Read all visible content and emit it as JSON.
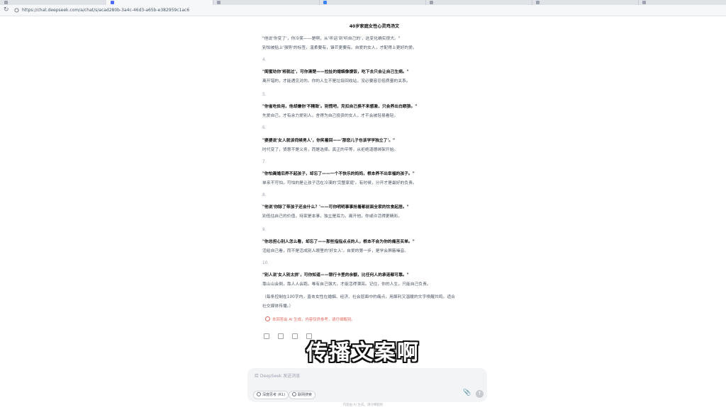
{
  "browser": {
    "url": "https://chat.deepseek.com/a/chat/s/acad280b-3a4c-46d3-a65b-e382959c1ac6",
    "tab_count": 7
  },
  "document": {
    "title": "40岁家庭女性心灵鸡汤文",
    "lines": [
      {
        "type": "body",
        "text": "\"他说'你变了'，你冷笑——是啊，从'听话'到'听自己的'，这变化确实很大。\""
      },
      {
        "type": "body",
        "text": "别怕被贴上'强势'的标签，温柔要有，锋芒更要有。自爱的女人，才配得上更好的爱。"
      },
      {
        "type": "num",
        "text": "4."
      },
      {
        "type": "bold",
        "text": "\"闺蜜劝你'将就过'，可你清楚——拉扯的婚姻像馊饭，吃下去只会让自己生病。\""
      },
      {
        "type": "body",
        "text": "离开错的，才能遇见对的。你的人生不是垃圾回收站，没必要容忍低质量的关系。"
      },
      {
        "type": "num",
        "text": "5."
      },
      {
        "type": "bold",
        "text": "\"你省吃俭用，他却嫌你'不精致'。别慌吧，克扣自己换不来感激，只会养出白眼狼。\""
      },
      {
        "type": "body",
        "text": "先爱自己，才有余力爱别人。舍得为自己投资的女人，才不会被轻易看轻。"
      },
      {
        "type": "num",
        "text": "6."
      },
      {
        "type": "bold",
        "text": "\"婆婆说'女人就该伺候男人'，你笑着回——'那您儿子也该学学独立了'。\""
      },
      {
        "type": "body",
        "text": "时代变了，贤惠不是义务，而是选择。真正的平等，从拒绝道德绑架开始。"
      },
      {
        "type": "num",
        "text": "7."
      },
      {
        "type": "bold",
        "text": "\"你怕离婚后养不起孩子，却忘了——一个不快乐的妈妈，根本养不出幸福的孩子。\""
      },
      {
        "type": "body",
        "text": "单亲不可怕，可怕的是让孩子活在冷漠的'完整家庭'。有时候，分开才是最好的负责。"
      },
      {
        "type": "num",
        "text": "8."
      },
      {
        "type": "bold",
        "text": "\"他说'你除了带孩子还会什么？'——可你明明事事抢着都前面全家的饮食起居。\""
      },
      {
        "type": "body",
        "text": "别低估自己的价值，持家是本事，独立是底力。离开他，你或许活得更精彩。"
      },
      {
        "type": "num",
        "text": "9."
      },
      {
        "type": "bold",
        "text": "\"你总担心别人怎么看，却忘了——那些指指点点的人，根本不会为你的痛苦买单。\""
      },
      {
        "type": "body",
        "text": "活给自己看，而不是活成别人眼里的'好女人'。自爱的第一步，是学会屏蔽噪音。"
      },
      {
        "type": "num",
        "text": "10."
      },
      {
        "type": "bold",
        "text": "\"别人说'女人别太拼'，可你知道——银行卡里的余额，比任何人的承诺都可靠。\""
      },
      {
        "type": "body",
        "text": "靠山山会倒，靠人人会跑。唯有自己强大，才能活得漂亮。记住，你的人生，只能自己负责。"
      },
      {
        "type": "note",
        "text": "（每条控制在100字内，直击女性在婚姻、经济、社会层面中的痛点，用犀利又温暖的文字唤醒共鸣，适合"
      },
      {
        "type": "note",
        "text": "社交媒体传播。）"
      }
    ],
    "disclaimer": "本回答由 AI 生成，内容仅供参考，请仔细甄别。"
  },
  "subtitle": "传播文案啊",
  "composer": {
    "placeholder": "给 DeepSeek 发送消息",
    "deepthink_label": "深度思考 (R1)",
    "search_label": "联网搜索",
    "attach_icon": "📎",
    "send_icon": "↑"
  },
  "footer": "内容由 AI 生成，请仔细甄别",
  "colors": {
    "accent": "#4d6bfe",
    "disclaimer": "#e46a5f",
    "tabbar": "#dfe3e8"
  }
}
